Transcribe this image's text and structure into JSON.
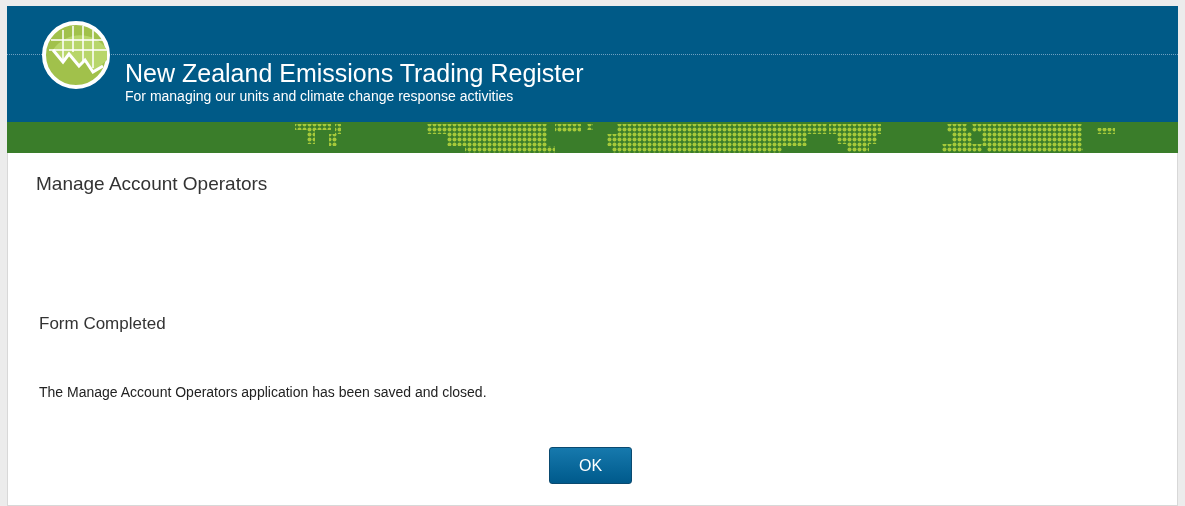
{
  "header": {
    "title": "New Zealand Emissions Trading Register",
    "subtitle": "For managing our units and climate change response activities"
  },
  "page_title": "Manage Account Operators",
  "status_heading": "Form Completed",
  "message": "The Manage Account Operators application has been saved and closed.",
  "buttons": [
    "OK"
  ]
}
